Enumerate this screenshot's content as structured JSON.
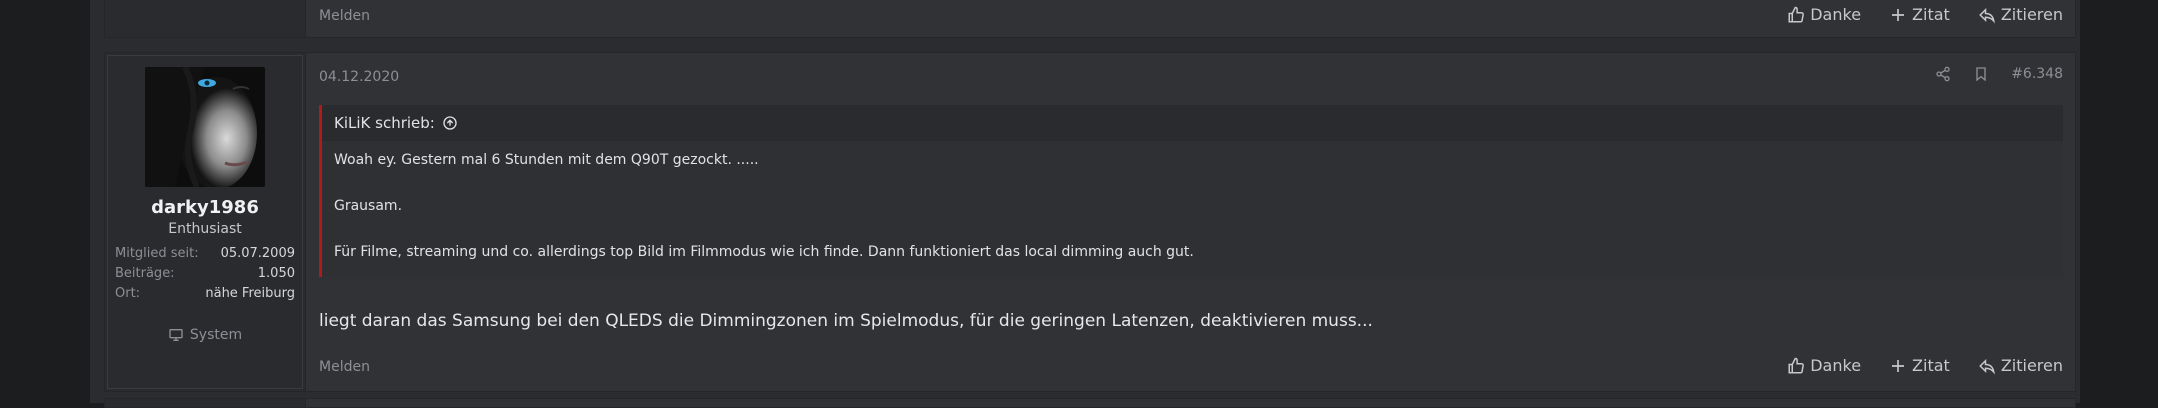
{
  "top_post": {
    "report_label": "Melden",
    "actions": {
      "thanks": "Danke",
      "add_quote": "Zitat",
      "reply_quote": "Zitieren"
    }
  },
  "post": {
    "date": "04.12.2020",
    "post_number": "#6.348",
    "user": {
      "name": "darky1986",
      "title": "Enthusiast",
      "stats": [
        {
          "label": "Mitglied seit:",
          "value": "05.07.2009"
        },
        {
          "label": "Beiträge:",
          "value": "1.050"
        },
        {
          "label": "Ort:",
          "value": "nähe Freiburg"
        }
      ],
      "system_label": "System"
    },
    "quote": {
      "author_line": "KiLiK schrieb:",
      "lines": [
        "Woah ey. Gestern mal 6 Stunden mit dem Q90T gezockt. .....",
        "Grausam.",
        "Für Filme, streaming und co. allerdings top Bild im Filmmodus wie ich finde. Dann funktioniert das local dimming auch gut."
      ]
    },
    "body": "liegt daran das Samsung bei den QLEDS die Dimmingzonen im Spielmodus, für die geringen Latenzen, deaktivieren muss...",
    "report_label": "Melden",
    "actions": {
      "thanks": "Danke",
      "add_quote": "Zitat",
      "reply_quote": "Zitieren"
    }
  },
  "colors": {
    "quote_bar": "#b11a1a",
    "background": "#1c1d1f",
    "panel": "#313235"
  },
  "icons": [
    "thumbs-up-icon",
    "plus-icon",
    "reply-icon",
    "share-icon",
    "bookmark-icon",
    "arrow-up-circle-icon",
    "monitor-icon"
  ]
}
